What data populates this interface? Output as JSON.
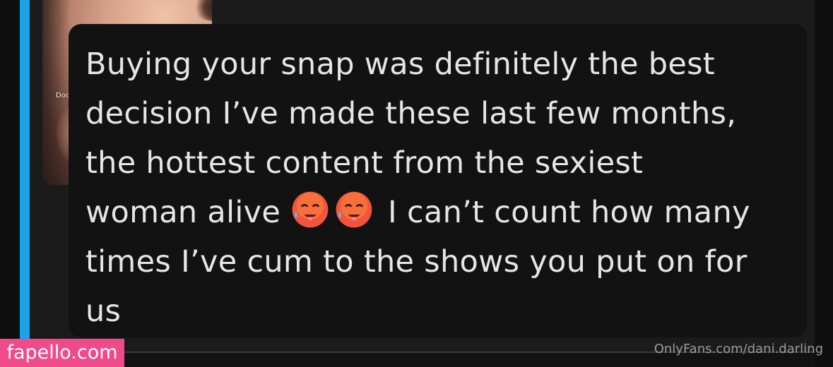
{
  "message": {
    "line1": "Buying your snap was definitely the best",
    "line2": "decision I’ve made these last few months,",
    "line3": "the hottest content from the sexiest",
    "line4_before": "woman alive ",
    "line4_after": "I can’t count how many",
    "line5": "times I’ve cum to the shows you put on for",
    "line6": "us",
    "emojis": [
      "hot-face-emoji",
      "hot-face-emoji"
    ]
  },
  "photo": {
    "label": "Doc"
  },
  "watermarks": {
    "site": "fapello.com",
    "source": "OnlyFans.com/dani.darling"
  },
  "colors": {
    "accent": "#1aa3e8",
    "watermark_bg": "#f04a8a",
    "bubble_bg": "#121212",
    "text": "#e6e6e6"
  }
}
